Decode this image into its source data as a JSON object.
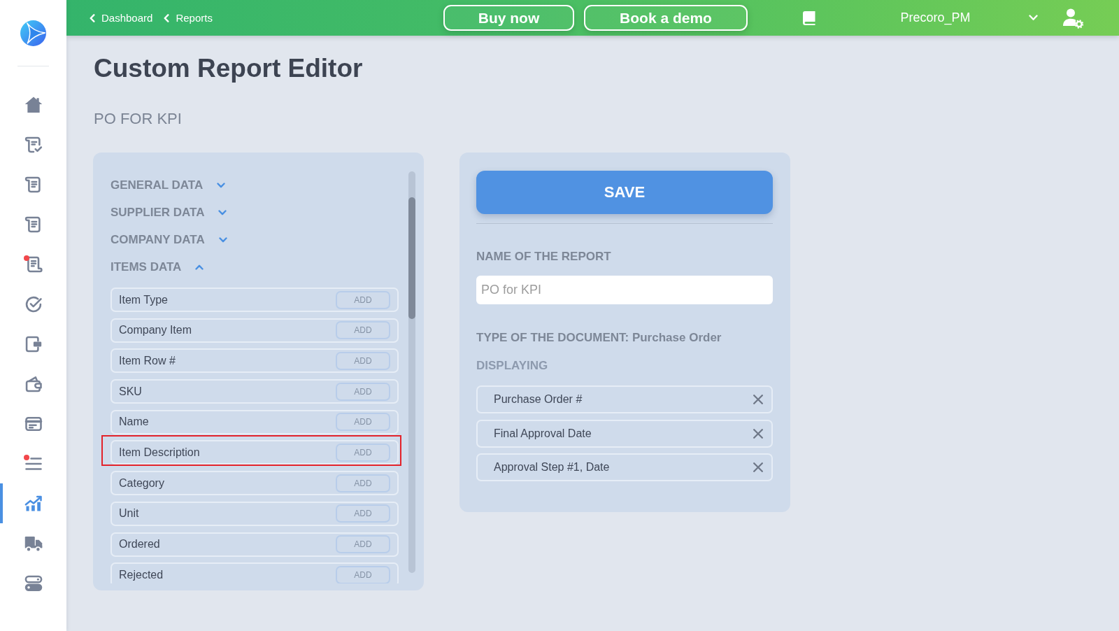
{
  "sidebar": {
    "items": [
      {
        "selected": false,
        "notification": false
      },
      {
        "selected": false,
        "notification": false
      },
      {
        "selected": false,
        "notification": false
      },
      {
        "selected": false,
        "notification": false
      },
      {
        "selected": false,
        "notification": true
      },
      {
        "selected": false,
        "notification": false
      },
      {
        "selected": false,
        "notification": false
      },
      {
        "selected": false,
        "notification": false
      },
      {
        "selected": false,
        "notification": false
      },
      {
        "selected": false,
        "notification": true
      },
      {
        "selected": true,
        "notification": false
      },
      {
        "selected": false,
        "notification": false
      },
      {
        "selected": false,
        "notification": false
      }
    ]
  },
  "topbar": {
    "breadcrumbs": [
      {
        "label": "Dashboard"
      },
      {
        "label": "Reports"
      }
    ],
    "buttons": [
      {
        "label": "Buy now"
      },
      {
        "label": "Book a demo"
      }
    ],
    "user": {
      "name": "Precoro_PM"
    }
  },
  "page": {
    "title": "Custom Report Editor",
    "subtitle": "PO FOR KPI"
  },
  "fields_panel": {
    "sections": [
      {
        "title": "GENERAL DATA",
        "expanded": false
      },
      {
        "title": "SUPPLIER DATA",
        "expanded": false
      },
      {
        "title": "COMPANY DATA",
        "expanded": false
      },
      {
        "title": "ITEMS DATA",
        "expanded": true,
        "fields": [
          {
            "label": "Item Type",
            "action": "ADD",
            "highlighted": false
          },
          {
            "label": "Company Item",
            "action": "ADD",
            "highlighted": false
          },
          {
            "label": "Item Row #",
            "action": "ADD",
            "highlighted": false
          },
          {
            "label": "SKU",
            "action": "ADD",
            "highlighted": false
          },
          {
            "label": "Name",
            "action": "ADD",
            "highlighted": false
          },
          {
            "label": "Item Description",
            "action": "ADD",
            "highlighted": true
          },
          {
            "label": "Category",
            "action": "ADD",
            "highlighted": false
          },
          {
            "label": "Unit",
            "action": "ADD",
            "highlighted": false
          },
          {
            "label": "Ordered",
            "action": "ADD",
            "highlighted": false
          },
          {
            "label": "Rejected",
            "action": "ADD",
            "highlighted": false
          }
        ]
      }
    ]
  },
  "report_panel": {
    "save_button": "SAVE",
    "name_label": "NAME OF THE REPORT",
    "name_input": {
      "value": "PO for KPI"
    },
    "document_type": "TYPE OF THE DOCUMENT: Purchase Order",
    "displaying_label": "DISPLAYING",
    "displaying": [
      {
        "label": "Purchase Order #"
      },
      {
        "label": "Final Approval Date"
      },
      {
        "label": "Approval Step #1, Date"
      }
    ]
  }
}
